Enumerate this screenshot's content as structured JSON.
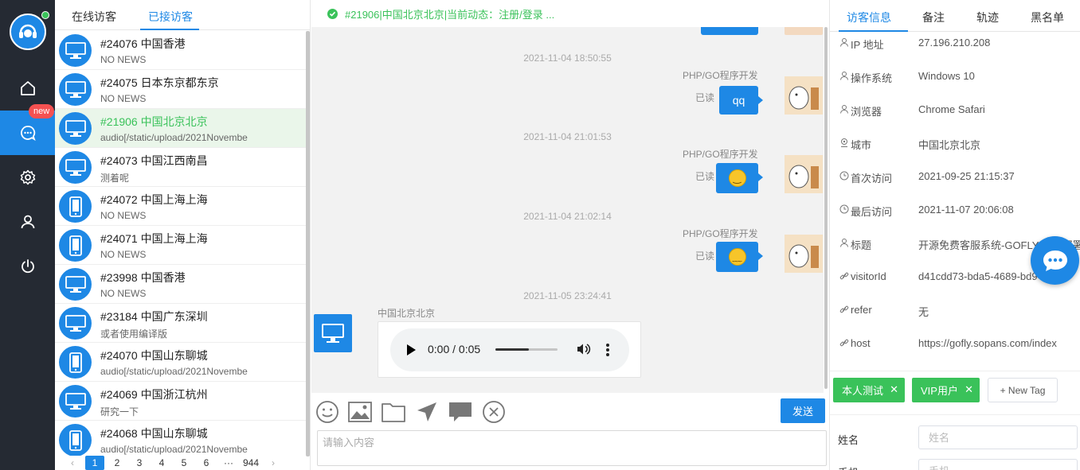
{
  "rail": {
    "badge_new": "new",
    "nav": [
      "home-icon",
      "chat-icon",
      "settings-icon",
      "user-icon",
      "power-icon"
    ],
    "accent": "#1e88e5",
    "bg": "#252a33"
  },
  "list": {
    "tabs": [
      "在线访客",
      "已接访客"
    ],
    "items": [
      {
        "name": "#24076 中国香港",
        "msg": "NO NEWS",
        "device": "desktop"
      },
      {
        "name": "#24075 日本东京都东京",
        "msg": "NO NEWS",
        "device": "desktop"
      },
      {
        "name": "#21906 中国北京北京",
        "msg": "audio[/static/upload/2021Novembe",
        "device": "desktop",
        "active": true
      },
      {
        "name": "#24073 中国江西南昌",
        "msg": "测着呢",
        "device": "desktop"
      },
      {
        "name": "#24072 中国上海上海",
        "msg": "NO NEWS",
        "device": "mobile"
      },
      {
        "name": "#24071 中国上海上海",
        "msg": "NO NEWS",
        "device": "mobile"
      },
      {
        "name": "#23998 中国香港",
        "msg": "NO NEWS",
        "device": "desktop"
      },
      {
        "name": "#23184 中国广东深圳",
        "msg": "或者使用编译版",
        "device": "desktop"
      },
      {
        "name": "#24070 中国山东聊城",
        "msg": "audio[/static/upload/2021Novembe",
        "device": "mobile"
      },
      {
        "name": "#24069 中国浙江杭州",
        "msg": "研究一下",
        "device": "desktop"
      },
      {
        "name": "#24068 中国山东聊城",
        "msg": "audio[/static/upload/2021Novembe",
        "device": "mobile"
      }
    ],
    "pager": {
      "prev": "‹",
      "pages": [
        "1",
        "2",
        "3",
        "4",
        "5",
        "6",
        "···",
        "944"
      ],
      "next": "›",
      "current": "1"
    }
  },
  "chat": {
    "header_status": "#21906|中国北京北京|当前动态：注册/登录 ...",
    "messages": [
      {
        "time": "2021-11-04 18:50:55",
        "sender": "PHP/GO程序开发",
        "read": "已读",
        "text": "qq"
      },
      {
        "time": "2021-11-04 21:01:53",
        "sender": "PHP/GO程序开发",
        "read": "已读",
        "emoji": "smile"
      },
      {
        "time": "2021-11-04 21:02:14",
        "sender": "PHP/GO程序开发",
        "read": "已读",
        "emoji": "smirk"
      },
      {
        "time": "2021-11-05 23:24:41",
        "sender": "中国北京北京",
        "audio_time": "0:00 / 0:05",
        "audio_progress": 0.54
      }
    ],
    "toolbar": [
      "smile-icon",
      "image-icon",
      "folder-icon",
      "send-plane-icon",
      "comment-icon",
      "close-circle-icon"
    ],
    "send_label": "发送",
    "input_placeholder": "请输入内容"
  },
  "info": {
    "tabs": [
      "访客信息",
      "备注",
      "轨迹",
      "黑名单"
    ],
    "rows": [
      {
        "key": "IP 地址",
        "value": "27.196.210.208",
        "icon": "user-icon"
      },
      {
        "key": "操作系统",
        "value": "Windows 10",
        "icon": "user-icon"
      },
      {
        "key": "浏览器",
        "value": "Chrome Safari",
        "icon": "user-icon"
      },
      {
        "key": "城市",
        "value": "中国北京北京",
        "icon": "location-icon"
      },
      {
        "key": "首次访问",
        "value": "2021-09-25 21:15:37",
        "icon": "clock-icon"
      },
      {
        "key": "最后访问",
        "value": "2021-11-07 20:06:08",
        "icon": "clock-icon"
      },
      {
        "key": "标题",
        "value": "开源免费客服系统-GOFLY-独立部署",
        "icon": "user-icon"
      },
      {
        "key": "visitorId",
        "value": "d41cdd73-bda5-4689-bd9",
        "icon": "link-icon"
      },
      {
        "key": "refer",
        "value": "无",
        "icon": "link-icon"
      },
      {
        "key": "host",
        "value": "https://gofly.sopans.com/index",
        "icon": "link-icon"
      }
    ],
    "tags": [
      "本人测试",
      "VIP用户"
    ],
    "new_tag": "+ New Tag",
    "form": {
      "name_label": "姓名",
      "name_placeholder": "姓名",
      "phone_label": "手机",
      "phone_placeholder": "手机"
    },
    "tag_color": "#3ac25a"
  }
}
